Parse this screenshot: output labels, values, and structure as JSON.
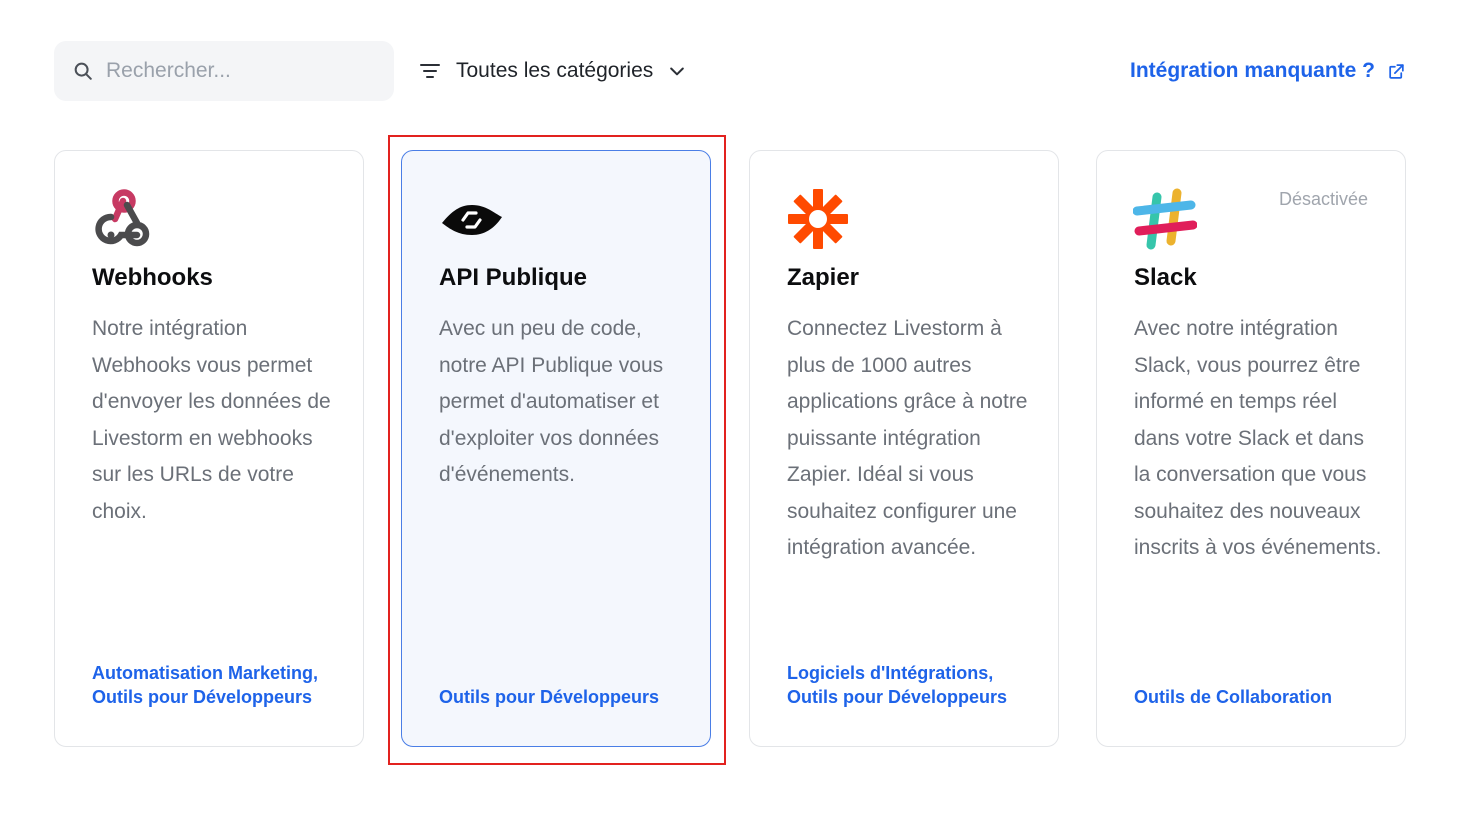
{
  "toolbar": {
    "search_placeholder": "Rechercher...",
    "search_value": "",
    "category_filter_label": "Toutes les catégories",
    "missing_integration_label": "Intégration manquante ?"
  },
  "cards": [
    {
      "title": "Webhooks",
      "icon": "webhooks-logo-icon",
      "description": "Notre intégration Webhooks vous permet d'envoyer les données de Livestorm en webhooks sur les URLs de votre choix.",
      "tags": "Automatisation Marketing, Outils pour Développeurs",
      "status": ""
    },
    {
      "title": "API Publique",
      "icon": "api-logo-icon",
      "description": "Avec un peu de code, notre API Publique vous permet d'automatiser et d'exploiter vos données d'événements.",
      "tags": "Outils pour Développeurs",
      "status": ""
    },
    {
      "title": "Zapier",
      "icon": "zapier-logo-icon",
      "description": "Connectez Livestorm à plus de 1000 autres applications grâce à notre puissante intégration Zapier. Idéal si vous souhaitez configurer une intégration avancée.",
      "tags": "Logiciels d'Intégrations, Outils pour Développeurs",
      "status": ""
    },
    {
      "title": "Slack",
      "icon": "slack-logo-icon",
      "description": "Avec notre intégration Slack, vous pourrez être informé en temps réel dans votre Slack et dans la conversation que vous souhaitez des nouveaux inscrits à vos événements.",
      "tags": "Outils de Collaboration",
      "status": "Désactivée"
    }
  ],
  "colors": {
    "link_blue": "#1e63e9",
    "selected_card_bg": "#f4f7fd",
    "selected_card_border": "#4a7ee6",
    "highlight_red": "#e2221f",
    "zapier_orange": "#ff4a00"
  }
}
